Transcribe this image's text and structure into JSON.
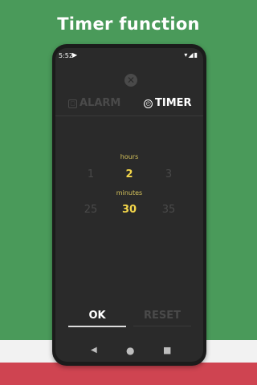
{
  "headline": "Timer function",
  "status": {
    "time": "5:52",
    "play_icon": "▶",
    "right_icons": "▾◢▮"
  },
  "close_glyph": "✕",
  "tabs": [
    {
      "label": "ALARM",
      "icon": "▢",
      "active": false
    },
    {
      "label": "TIMER",
      "icon": "◴",
      "active": true
    }
  ],
  "hours": {
    "label": "hours",
    "values": [
      "1",
      "2",
      "3"
    ],
    "selected": "2"
  },
  "minutes": {
    "label": "minutes",
    "values": [
      "25",
      "30",
      "35"
    ],
    "selected": "30"
  },
  "buttons": {
    "ok": "OK",
    "reset": "RESET"
  },
  "navbar": {
    "back": "◀",
    "home": "●",
    "recent": "■"
  },
  "colors": {
    "background_green": "#4a9a5a",
    "accent_yellow": "#f2d54a",
    "label_yellow": "#d4c15a",
    "screen_bg": "#2a2a2a",
    "stripe_red": "#cf4451"
  }
}
